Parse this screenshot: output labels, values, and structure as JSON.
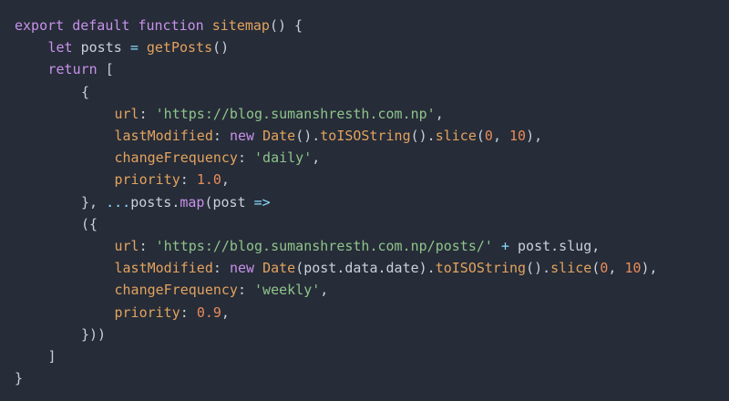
{
  "colors": {
    "background": "#262c38",
    "keyword": "#c792ea",
    "function": "#e3a35e",
    "string": "#8fc48b",
    "number": "#e88c5a",
    "property": "#e3a35e",
    "plain": "#c9d1d9",
    "operator": "#89ddff",
    "punctuation": "#c9d1d9"
  },
  "code": {
    "lines": [
      {
        "indent": 0,
        "tokens": [
          {
            "t": "export",
            "k": "keyword"
          },
          {
            "t": " ",
            "k": "plain"
          },
          {
            "t": "default",
            "k": "keyword"
          },
          {
            "t": " ",
            "k": "plain"
          },
          {
            "t": "function",
            "k": "keyword"
          },
          {
            "t": " ",
            "k": "plain"
          },
          {
            "t": "sitemap",
            "k": "function"
          },
          {
            "t": "() {",
            "k": "punctuation"
          }
        ]
      },
      {
        "indent": 1,
        "tokens": [
          {
            "t": "let",
            "k": "keyword"
          },
          {
            "t": " posts ",
            "k": "plain"
          },
          {
            "t": "=",
            "k": "operator"
          },
          {
            "t": " ",
            "k": "plain"
          },
          {
            "t": "getPosts",
            "k": "function"
          },
          {
            "t": "()",
            "k": "punctuation"
          }
        ]
      },
      {
        "indent": 1,
        "tokens": [
          {
            "t": "return",
            "k": "keyword"
          },
          {
            "t": " [",
            "k": "punctuation"
          }
        ]
      },
      {
        "indent": 2,
        "tokens": [
          {
            "t": "{",
            "k": "punctuation"
          }
        ]
      },
      {
        "indent": 3,
        "tokens": [
          {
            "t": "url",
            "k": "property"
          },
          {
            "t": ": ",
            "k": "punctuation"
          },
          {
            "t": "'https://blog.sumanshresth.com.np'",
            "k": "string"
          },
          {
            "t": ",",
            "k": "punctuation"
          }
        ]
      },
      {
        "indent": 3,
        "tokens": [
          {
            "t": "lastModified",
            "k": "property"
          },
          {
            "t": ": ",
            "k": "punctuation"
          },
          {
            "t": "new",
            "k": "keyword"
          },
          {
            "t": " ",
            "k": "plain"
          },
          {
            "t": "Date",
            "k": "function"
          },
          {
            "t": "().",
            "k": "punctuation"
          },
          {
            "t": "toISOString",
            "k": "function"
          },
          {
            "t": "().",
            "k": "punctuation"
          },
          {
            "t": "slice",
            "k": "function"
          },
          {
            "t": "(",
            "k": "punctuation"
          },
          {
            "t": "0",
            "k": "number"
          },
          {
            "t": ", ",
            "k": "punctuation"
          },
          {
            "t": "10",
            "k": "number"
          },
          {
            "t": "),",
            "k": "punctuation"
          }
        ]
      },
      {
        "indent": 3,
        "tokens": [
          {
            "t": "changeFrequency",
            "k": "property"
          },
          {
            "t": ": ",
            "k": "punctuation"
          },
          {
            "t": "'daily'",
            "k": "string"
          },
          {
            "t": ",",
            "k": "punctuation"
          }
        ]
      },
      {
        "indent": 3,
        "tokens": [
          {
            "t": "priority",
            "k": "property"
          },
          {
            "t": ": ",
            "k": "punctuation"
          },
          {
            "t": "1.0",
            "k": "number"
          },
          {
            "t": ",",
            "k": "punctuation"
          }
        ]
      },
      {
        "indent": 2,
        "tokens": [
          {
            "t": "}, ",
            "k": "punctuation"
          },
          {
            "t": "...",
            "k": "operator"
          },
          {
            "t": "posts.",
            "k": "plain"
          },
          {
            "t": "map",
            "k": "keyword"
          },
          {
            "t": "(post ",
            "k": "plain"
          },
          {
            "t": "=>",
            "k": "operator"
          }
        ]
      },
      {
        "indent": 2,
        "tokens": [
          {
            "t": "({",
            "k": "punctuation"
          }
        ]
      },
      {
        "indent": 3,
        "tokens": [
          {
            "t": "url",
            "k": "property"
          },
          {
            "t": ": ",
            "k": "punctuation"
          },
          {
            "t": "'https://blog.sumanshresth.com.np/posts/'",
            "k": "string"
          },
          {
            "t": " ",
            "k": "plain"
          },
          {
            "t": "+",
            "k": "operator"
          },
          {
            "t": " post.slug,",
            "k": "plain"
          }
        ]
      },
      {
        "indent": 3,
        "tokens": [
          {
            "t": "lastModified",
            "k": "property"
          },
          {
            "t": ": ",
            "k": "punctuation"
          },
          {
            "t": "new",
            "k": "keyword"
          },
          {
            "t": " ",
            "k": "plain"
          },
          {
            "t": "Date",
            "k": "function"
          },
          {
            "t": "(post.data.date).",
            "k": "plain"
          },
          {
            "t": "toISOString",
            "k": "function"
          },
          {
            "t": "().",
            "k": "punctuation"
          },
          {
            "t": "slice",
            "k": "function"
          },
          {
            "t": "(",
            "k": "punctuation"
          },
          {
            "t": "0",
            "k": "number"
          },
          {
            "t": ", ",
            "k": "punctuation"
          },
          {
            "t": "10",
            "k": "number"
          },
          {
            "t": "),",
            "k": "punctuation"
          }
        ]
      },
      {
        "indent": 3,
        "tokens": [
          {
            "t": "changeFrequency",
            "k": "property"
          },
          {
            "t": ": ",
            "k": "punctuation"
          },
          {
            "t": "'weekly'",
            "k": "string"
          },
          {
            "t": ",",
            "k": "punctuation"
          }
        ]
      },
      {
        "indent": 3,
        "tokens": [
          {
            "t": "priority",
            "k": "property"
          },
          {
            "t": ": ",
            "k": "punctuation"
          },
          {
            "t": "0.9",
            "k": "number"
          },
          {
            "t": ",",
            "k": "punctuation"
          }
        ]
      },
      {
        "indent": 2,
        "tokens": [
          {
            "t": "}))",
            "k": "punctuation"
          }
        ]
      },
      {
        "indent": 1,
        "tokens": [
          {
            "t": "]",
            "k": "punctuation"
          }
        ]
      },
      {
        "indent": 0,
        "tokens": [
          {
            "t": "}",
            "k": "punctuation"
          }
        ]
      }
    ]
  }
}
